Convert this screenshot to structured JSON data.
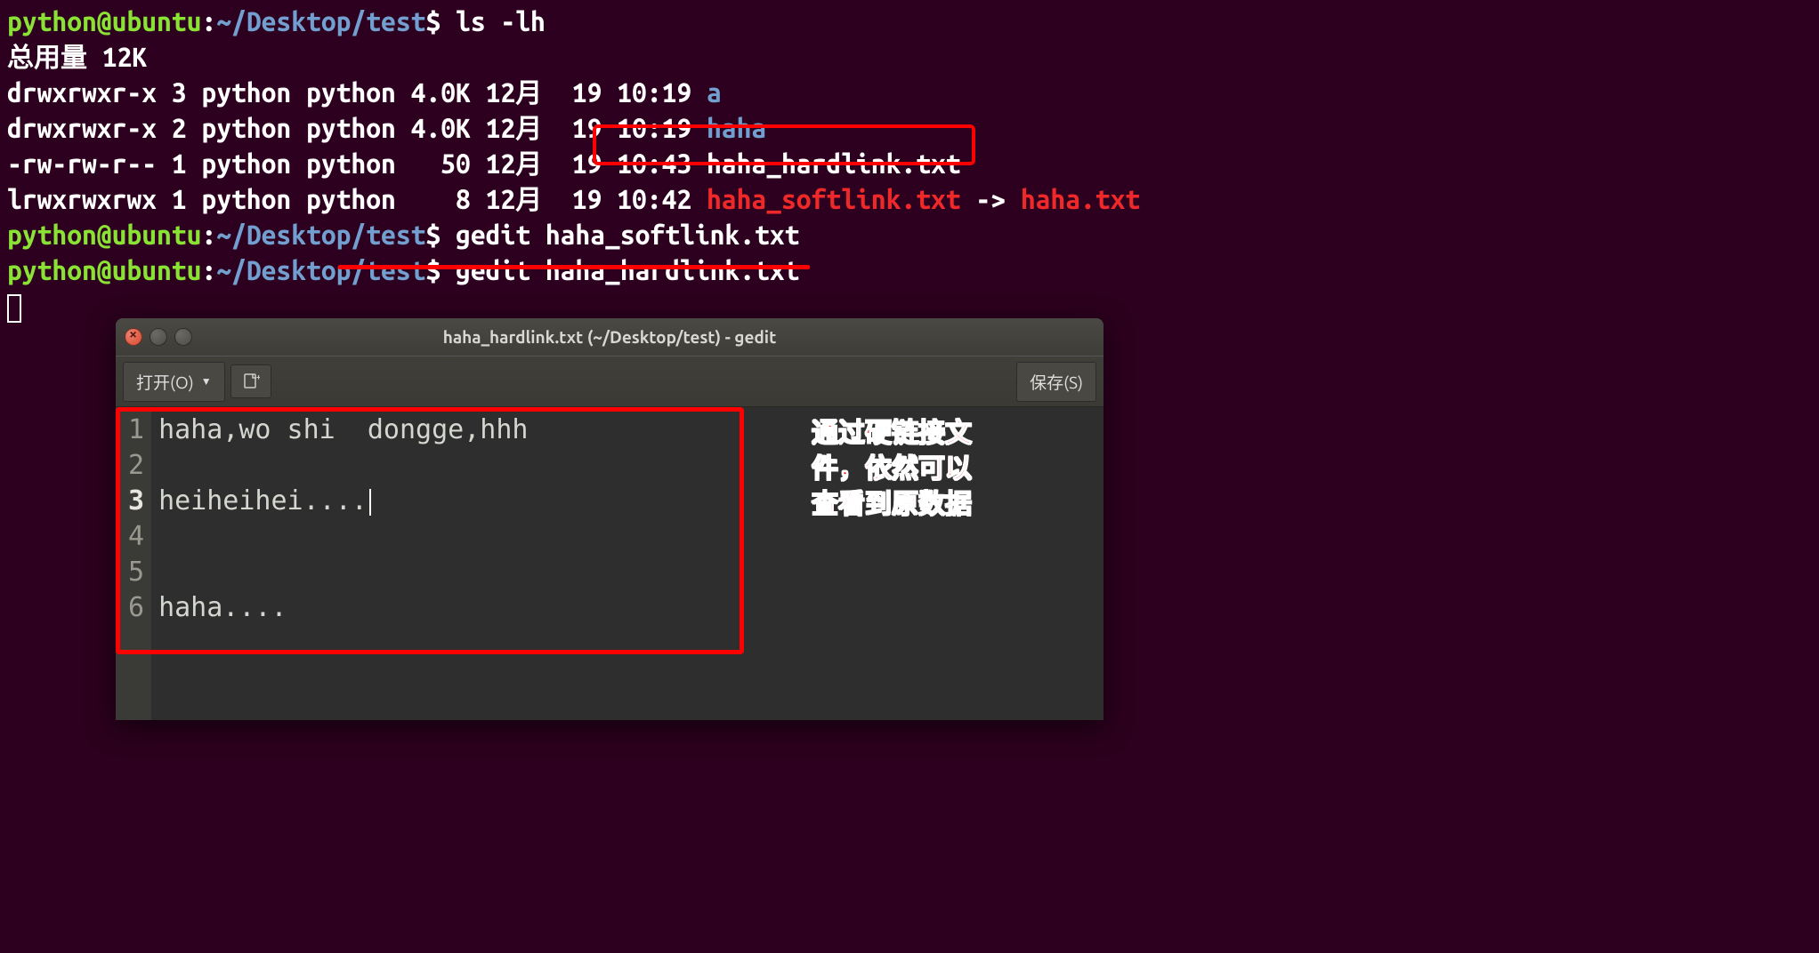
{
  "terminal": {
    "prompt_user": "python@ubuntu",
    "prompt_sep": ":",
    "prompt_path": "~/Desktop/test",
    "prompt_dollar": "$",
    "cmd1": "ls -lh",
    "total_line": "总用量 12K",
    "rows": [
      {
        "perm": "drwxrwxr-x",
        "n": "3",
        "u": "python",
        "g": "python",
        "size": "4.0K",
        "mon": "12月",
        "day": "19",
        "time": "10:19",
        "name": "a",
        "cls": "dir"
      },
      {
        "perm": "drwxrwxr-x",
        "n": "2",
        "u": "python",
        "g": "python",
        "size": "4.0K",
        "mon": "12月",
        "day": "19",
        "time": "10:19",
        "name": "haha",
        "cls": "dir"
      },
      {
        "perm": "-rw-rw-r--",
        "n": "1",
        "u": "python",
        "g": "python",
        "size": "50",
        "mon": "12月",
        "day": "19",
        "time": "10:43",
        "name": "haha_hardlink.txt",
        "cls": "file"
      },
      {
        "perm": "lrwxrwxrwx",
        "n": "1",
        "u": "python",
        "g": "python",
        "size": "8",
        "mon": "12月",
        "day": "19",
        "time": "10:42",
        "name": "haha_softlink.txt",
        "target": "haha.txt",
        "cls": "sym"
      }
    ],
    "cmd2": "gedit haha_softlink.txt",
    "cmd3": "gedit haha_hardlink.txt"
  },
  "gedit": {
    "title": "haha_hardlink.txt (~/Desktop/test) - gedit",
    "open_label": "打开(O)",
    "save_label": "保存(S)",
    "lines": [
      "haha,wo shi  dongge,hhh",
      "",
      "heiheihei....",
      "",
      "",
      "haha...."
    ],
    "current_line_index": 2
  },
  "annotation": {
    "text": "通过硬链接文\n件，依然可以\n查看到原数据"
  }
}
